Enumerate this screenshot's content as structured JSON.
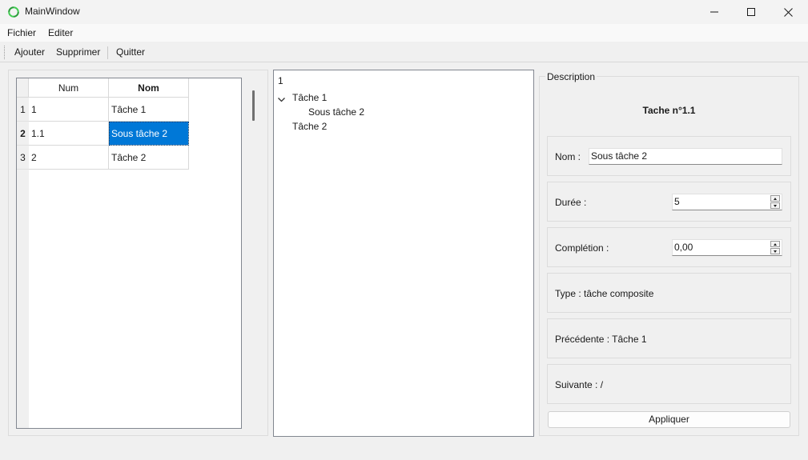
{
  "window": {
    "title": "MainWindow",
    "icon": "qt-app-icon",
    "controls": [
      "minimize-icon",
      "maximize-icon",
      "close-icon"
    ]
  },
  "menubar": {
    "items": [
      "Fichier",
      "Editer"
    ]
  },
  "toolbar": {
    "buttons": [
      "Ajouter",
      "Supprimer",
      "Quitter"
    ]
  },
  "table": {
    "headers": [
      "Num",
      "Nom"
    ],
    "rows": [
      {
        "row_number": "1",
        "num": "1",
        "nom": "Tâche 1"
      },
      {
        "row_number": "2",
        "num": "1.1",
        "nom": "Sous tâche 2"
      },
      {
        "row_number": "3",
        "num": "2",
        "nom": "Tâche 2"
      }
    ],
    "selected_row": 2,
    "selection_color": "#0078d7"
  },
  "tree": {
    "header": "1",
    "items": [
      {
        "label": "Tâche 1",
        "expanded": true
      },
      {
        "label": "Sous tâche 2",
        "parent": "Tâche 1"
      },
      {
        "label": "Tâche 2"
      }
    ]
  },
  "description": {
    "group_title": "Description",
    "heading": "Tache n°1.1",
    "nom_label": "Nom :",
    "nom_value": "Sous tâche 2",
    "duree_label": "Durée :",
    "duree_value": "5",
    "completion_label": "Complétion :",
    "completion_value": "0,00",
    "type_text": "Type : tâche composite",
    "precedente_text": "Précédente : Tâche 1",
    "suivante_text": "Suivante : /",
    "apply_label": "Appliquer"
  }
}
